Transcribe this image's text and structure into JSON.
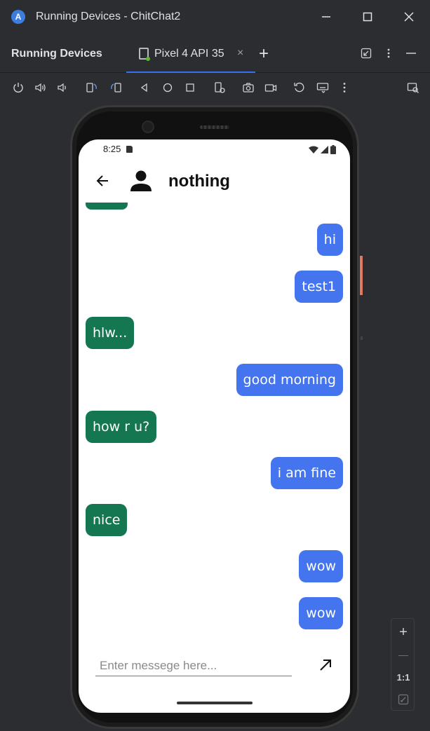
{
  "window": {
    "title": "Running Devices - ChitChat2",
    "logo_text": "A",
    "controls": [
      "minimize-icon",
      "maximize-icon",
      "close-icon"
    ]
  },
  "panel": {
    "title": "Running Devices",
    "tab_label": "Pixel 4 API 35",
    "tab_close": "×",
    "add_tab": "+"
  },
  "toolbar": {
    "icons": [
      "power-icon",
      "volume-up-icon",
      "volume-down-icon",
      "rotate-left-icon",
      "rotate-right-icon",
      "back-icon",
      "home-icon",
      "overview-icon",
      "device-settings-icon",
      "screenshot-icon",
      "screen-record-icon",
      "reset-icon",
      "keyboard-icon",
      "more-icon",
      "device-explorer-icon"
    ]
  },
  "device": {
    "status_time": "8:25",
    "contact_name": "nothing",
    "messages": [
      {
        "text": "hi",
        "side": "sent"
      },
      {
        "text": "test1",
        "side": "sent"
      },
      {
        "text": "hlw...",
        "side": "recv"
      },
      {
        "text": "good morning",
        "side": "sent"
      },
      {
        "text": "how r u?",
        "side": "recv"
      },
      {
        "text": "i am fine",
        "side": "sent"
      },
      {
        "text": "nice",
        "side": "recv"
      },
      {
        "text": "wow",
        "side": "sent"
      },
      {
        "text": "wow",
        "side": "sent"
      }
    ],
    "input_placeholder": "Enter messege here...",
    "input_value": ""
  },
  "zoom": {
    "zoom_in": "+",
    "zoom_out": "—",
    "actual_size": "1:1"
  },
  "colors": {
    "sent_bubble": "#4475ee",
    "recv_bubble": "#147752",
    "ide_background": "#2b2d30",
    "tab_underline": "#3574f0"
  }
}
